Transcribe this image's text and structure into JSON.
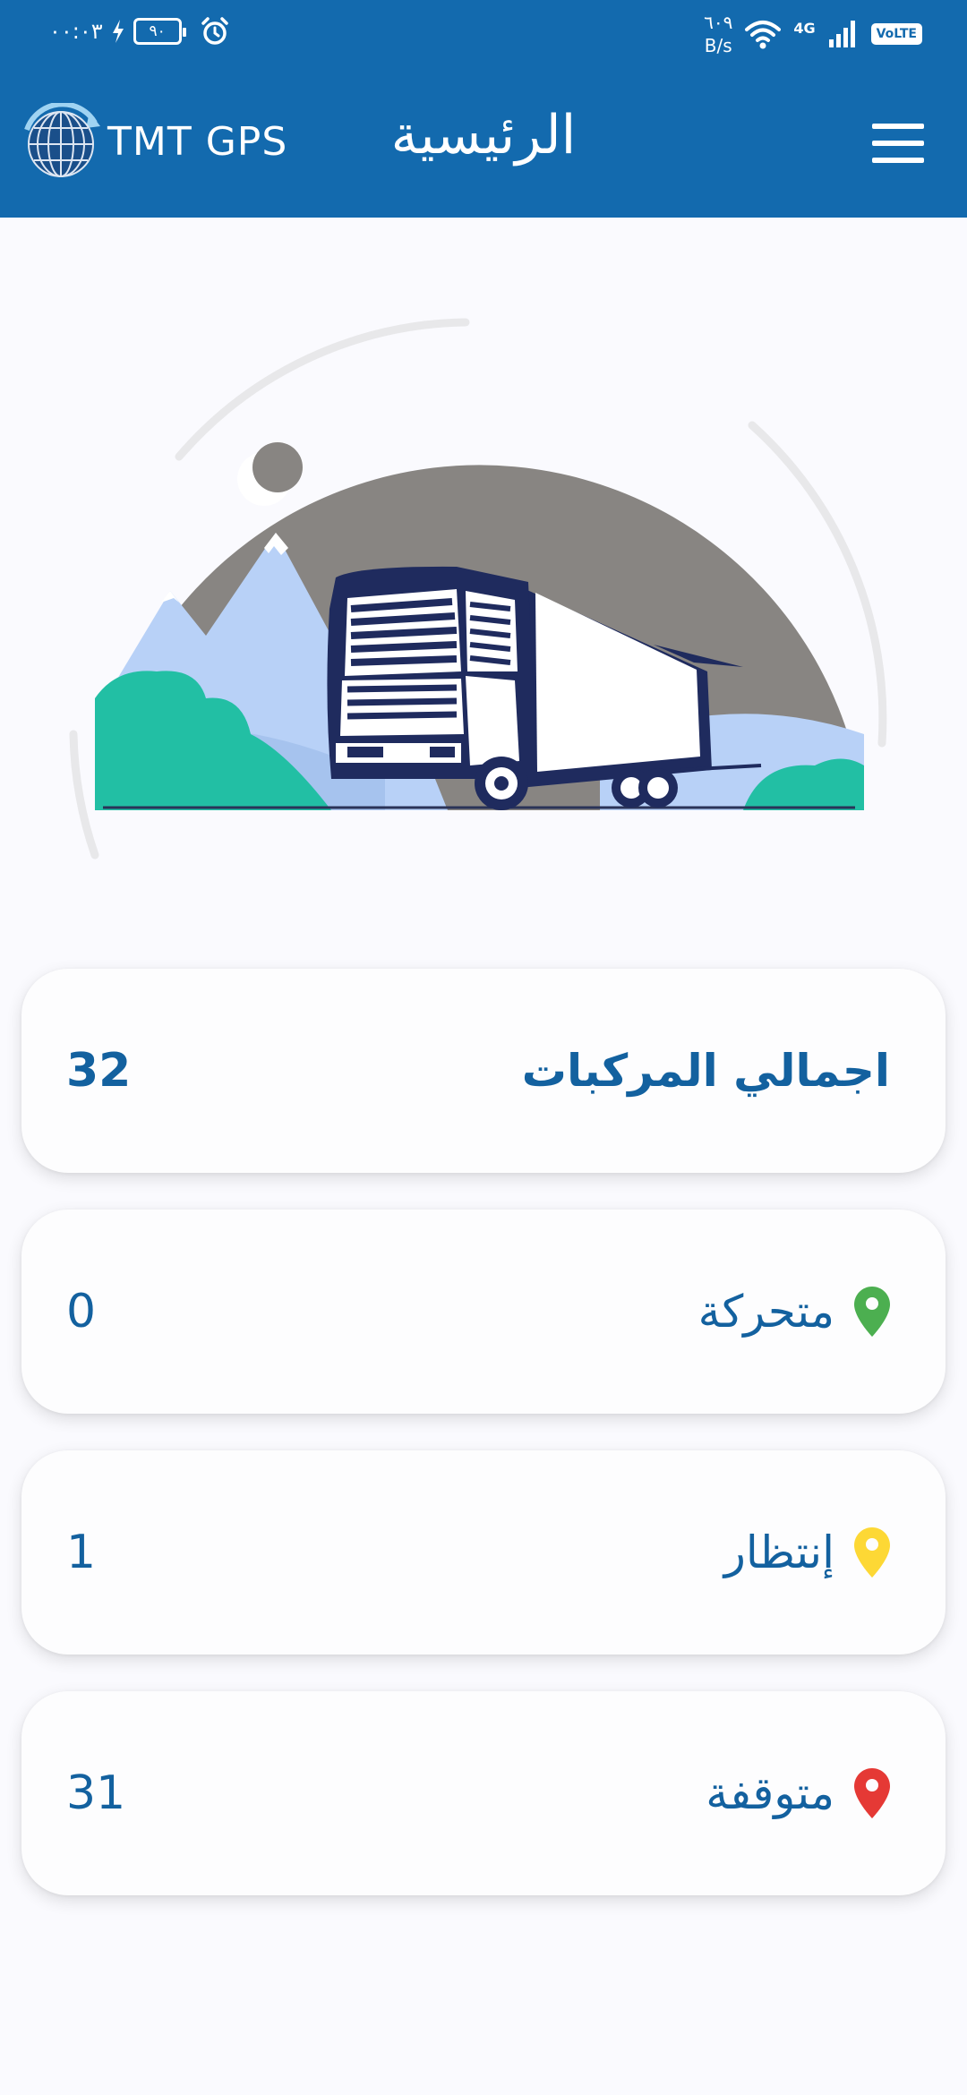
{
  "status_bar": {
    "time": "٠٠:٠٣",
    "battery": "٩٠",
    "net_speed_value": "٦٠٩",
    "net_speed_unit": "B/s",
    "network": "4G",
    "volte": "VoLTE"
  },
  "header": {
    "logo_text": "TMT GPS",
    "title": "الرئيسية",
    "menu_icon": "hamburger-menu-icon"
  },
  "hero": {
    "illustration": "truck-night-mountains-illustration"
  },
  "stats": [
    {
      "label": "اجمالي المركبات",
      "value": "32",
      "icon": "none"
    },
    {
      "label": "متحركة",
      "value": "0",
      "icon": "location-pin-icon",
      "color": "#4caf50"
    },
    {
      "label": "إنتظار",
      "value": "1",
      "icon": "location-pin-icon",
      "color": "#fdd835"
    },
    {
      "label": "متوقفة",
      "value": "31",
      "icon": "location-pin-icon",
      "color": "#e53935"
    }
  ],
  "colors": {
    "primary": "#136aae",
    "text_primary": "#13619f",
    "background": "#fafafe"
  }
}
